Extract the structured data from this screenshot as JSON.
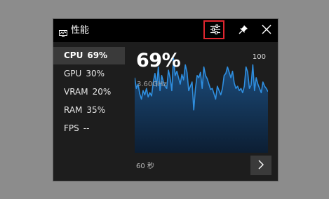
{
  "window": {
    "title": "性能",
    "icons": [
      "performance-monitor-icon",
      "settings-sliders-icon",
      "pin-icon",
      "close-icon"
    ]
  },
  "sidebar": {
    "items": [
      {
        "label": "CPU",
        "value": "69%",
        "active": true
      },
      {
        "label": "GPU",
        "value": "30%",
        "active": false
      },
      {
        "label": "VRAM",
        "value": "20%",
        "active": false
      },
      {
        "label": "RAM",
        "value": "35%",
        "active": false
      },
      {
        "label": "FPS",
        "value": "--",
        "active": false
      }
    ]
  },
  "detail": {
    "percent": "69%",
    "frequency": "3.60GHz",
    "max_label": "100",
    "time_window": "60 秒"
  },
  "colors": {
    "accent": "#2f8fe0",
    "fill_top": "#1d4f80",
    "fill_bottom": "#0c1e33",
    "highlight": "#e0262f"
  },
  "chart_data": {
    "type": "area",
    "ylim": [
      0,
      100
    ],
    "values": [
      70,
      60,
      64,
      55,
      50,
      58,
      54,
      60,
      52,
      56,
      53,
      66,
      74,
      62,
      80,
      58,
      72,
      66,
      62,
      60,
      77,
      70,
      58,
      88,
      72,
      76,
      70,
      64,
      73,
      68,
      82,
      75,
      58,
      62,
      66,
      40,
      60,
      72,
      70,
      75,
      60,
      80,
      72,
      69,
      64,
      59,
      60,
      55,
      50,
      62,
      58,
      54,
      60,
      72,
      74,
      80,
      75,
      70,
      76,
      65,
      60,
      62,
      58,
      60,
      56,
      62,
      80,
      75,
      60,
      63,
      82,
      58,
      70,
      64,
      60,
      56,
      66,
      62,
      60,
      57
    ]
  }
}
